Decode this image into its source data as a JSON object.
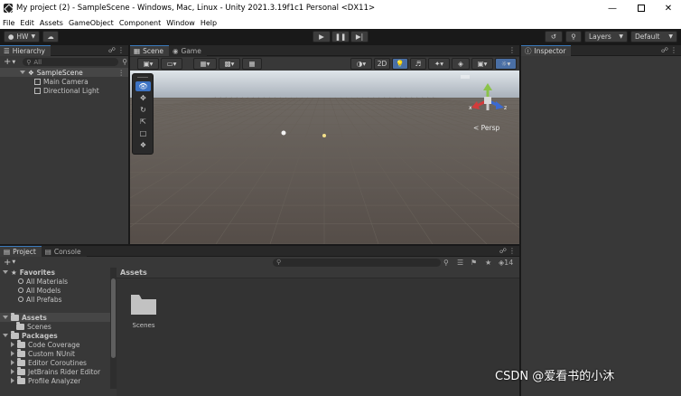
{
  "window": {
    "title": "My project (2) - SampleScene - Windows, Mac, Linux - Unity 2021.3.19f1c1 Personal <DX11>"
  },
  "menu": [
    "File",
    "Edit",
    "Assets",
    "GameObject",
    "Component",
    "Window",
    "Help"
  ],
  "toolbar": {
    "account": "HW",
    "layers": "Layers",
    "layout": "Default"
  },
  "hierarchy": {
    "tab": "Hierarchy",
    "search_placeholder": "All",
    "scene": "SampleScene",
    "objects": [
      "Main Camera",
      "Directional Light"
    ]
  },
  "scene": {
    "tabs": [
      "Scene",
      "Game"
    ],
    "mode_2d": "2D",
    "persp_label": "< Persp",
    "gizmo_axes": {
      "x": "x",
      "z": "z"
    }
  },
  "inspector": {
    "tab": "Inspector"
  },
  "project": {
    "tabs": [
      "Project",
      "Console"
    ],
    "count": "14",
    "favorites": {
      "label": "Favorites",
      "items": [
        "All Materials",
        "All Models",
        "All Prefabs"
      ]
    },
    "assets": {
      "label": "Assets",
      "items": [
        "Scenes"
      ]
    },
    "packages": {
      "label": "Packages",
      "items": [
        "Code Coverage",
        "Custom NUnit",
        "Editor Coroutines",
        "JetBrains Rider Editor",
        "Profile Analyzer"
      ]
    },
    "content_header": "Assets",
    "content_items": [
      "Scenes"
    ]
  },
  "watermark": "CSDN @爱看书的小沐",
  "colors": {
    "accent": "#3a79bb",
    "selection": "#2c5d87",
    "panel": "#383838",
    "sky": "#b9c2cc",
    "ground": "#5b544f"
  }
}
